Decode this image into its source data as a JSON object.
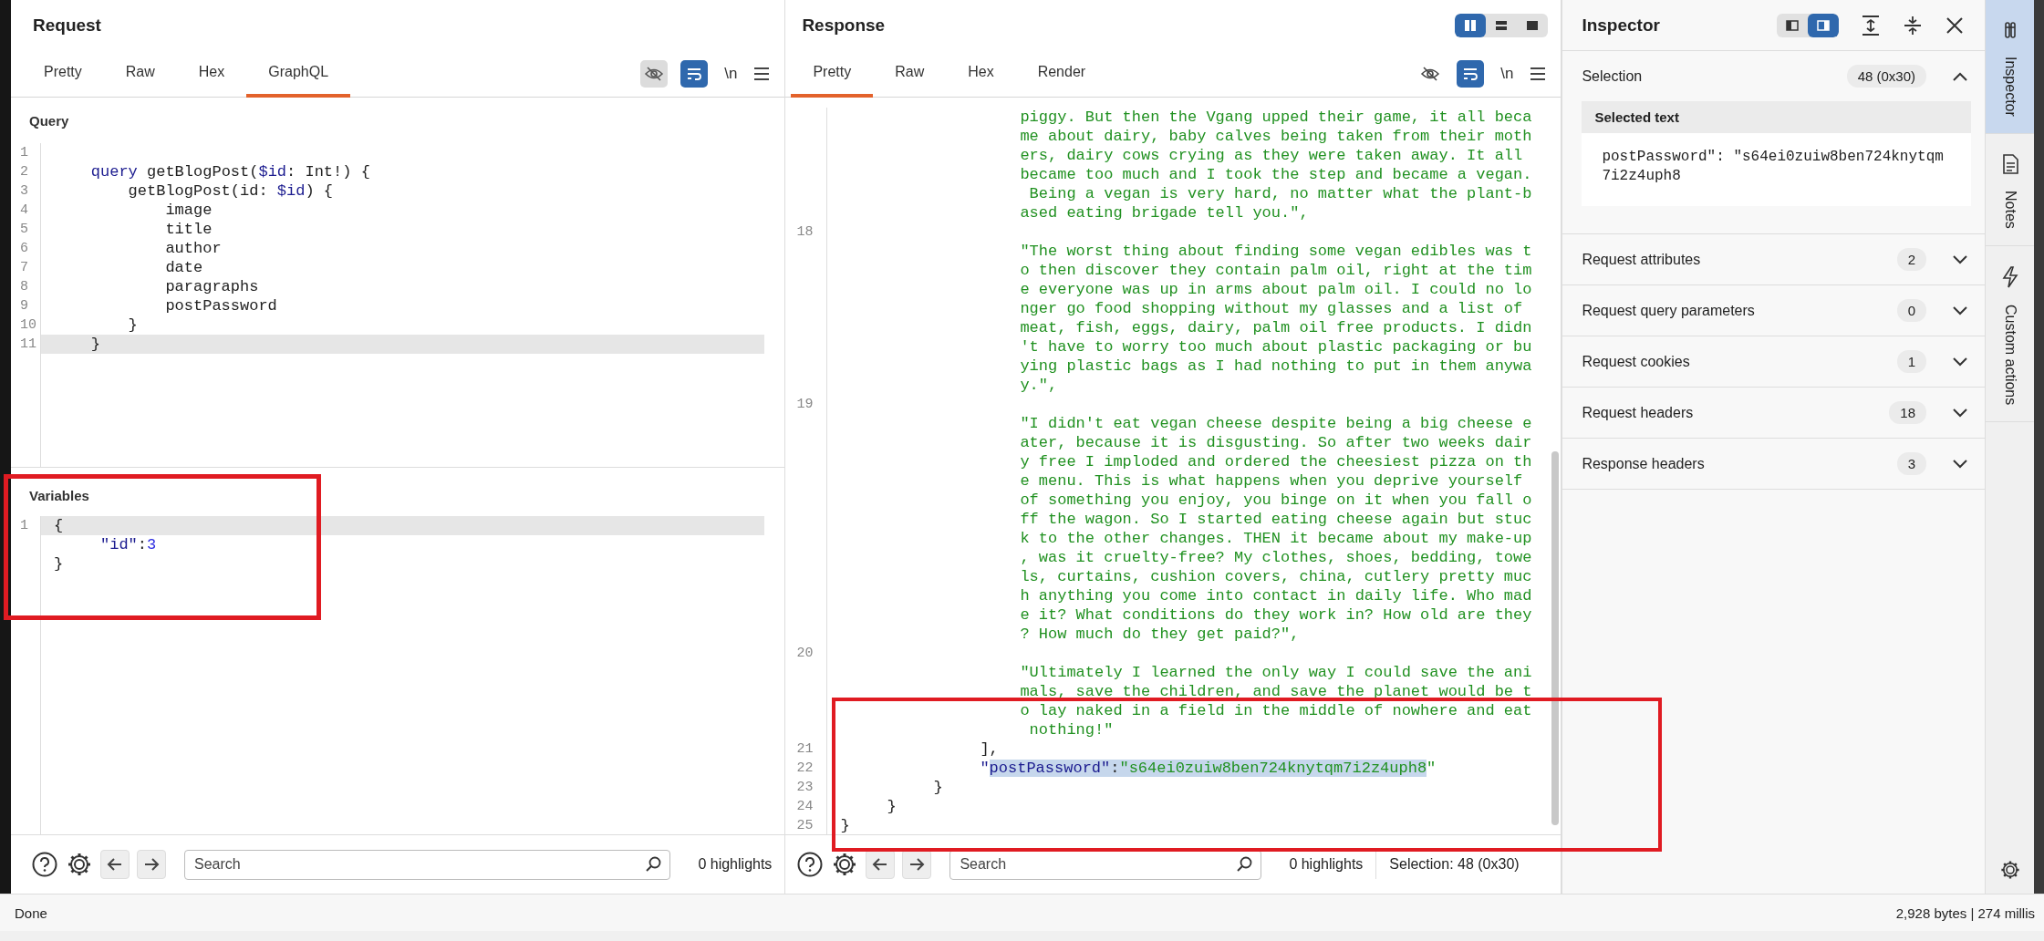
{
  "request": {
    "title": "Request",
    "tabs": [
      {
        "label": "Pretty",
        "selected": false
      },
      {
        "label": "Raw",
        "selected": false
      },
      {
        "label": "Hex",
        "selected": false
      },
      {
        "label": "GraphQL",
        "selected": true
      }
    ],
    "eye_toggle_on": true,
    "newline_label": "\\n",
    "query_label": "Query",
    "query_lines": [
      {
        "number": "1",
        "current": false
      },
      {
        "number": "2",
        "current": false,
        "segments": [
          {
            "kind": "kw",
            "text": "    query"
          },
          {
            "kind": "plain",
            "text": " getBlogPost("
          },
          {
            "kind": "var",
            "text": "$id"
          },
          {
            "kind": "plain",
            "text": ": Int!) {"
          }
        ]
      },
      {
        "number": "3",
        "current": false,
        "segments": [
          {
            "kind": "plain",
            "text": "        getBlogPost(id: "
          },
          {
            "kind": "var",
            "text": "$id"
          },
          {
            "kind": "plain",
            "text": ") {"
          }
        ]
      },
      {
        "number": "4",
        "current": false,
        "segments": [
          {
            "kind": "plain",
            "text": "            image"
          }
        ]
      },
      {
        "number": "5",
        "current": false,
        "segments": [
          {
            "kind": "plain",
            "text": "            title"
          }
        ]
      },
      {
        "number": "6",
        "current": false,
        "segments": [
          {
            "kind": "plain",
            "text": "            author"
          }
        ]
      },
      {
        "number": "7",
        "current": false,
        "segments": [
          {
            "kind": "plain",
            "text": "            date"
          }
        ]
      },
      {
        "number": "8",
        "current": false,
        "segments": [
          {
            "kind": "plain",
            "text": "            paragraphs"
          }
        ]
      },
      {
        "number": "9",
        "current": false,
        "segments": [
          {
            "kind": "plain",
            "text": "            postPassword"
          }
        ]
      },
      {
        "number": "10",
        "current": false,
        "segments": [
          {
            "kind": "plain",
            "text": "        }"
          }
        ]
      },
      {
        "number": "11",
        "current": true,
        "segments": [
          {
            "kind": "plain",
            "text": "    }"
          }
        ]
      }
    ],
    "variables_label": "Variables",
    "variables_lines": [
      {
        "number": "1",
        "current": true,
        "segments": [
          {
            "kind": "plain",
            "text": "{"
          }
        ]
      },
      {
        "current": false,
        "segments": [
          {
            "kind": "key",
            "text": "     \"id\""
          },
          {
            "kind": "plain",
            "text": ":"
          },
          {
            "kind": "num",
            "text": "3"
          }
        ]
      },
      {
        "current": false,
        "segments": [
          {
            "kind": "plain",
            "text": "}"
          }
        ]
      }
    ],
    "search_placeholder": "Search",
    "highlights": "0 highlights"
  },
  "response": {
    "title": "Response",
    "layout_buttons": [
      {
        "selected": true
      },
      {
        "selected": false
      },
      {
        "selected": false
      }
    ],
    "tabs": [
      {
        "label": "Pretty",
        "selected": true
      },
      {
        "label": "Raw",
        "selected": false
      },
      {
        "label": "Hex",
        "selected": false
      },
      {
        "label": "Render",
        "selected": false
      }
    ],
    "eye_toggle_on": false,
    "newline_label": "\\n",
    "rows": [
      {
        "kind": "wrap",
        "text": "piggy. But then the Vgang upped their game, it all beca"
      },
      {
        "kind": "wrap",
        "text": "me about dairy, baby calves being taken from their moth"
      },
      {
        "kind": "wrap",
        "text": "ers, dairy cows crying as they were taken away. It all "
      },
      {
        "kind": "wrap",
        "text": "became too much and I took the step and became a vegan."
      },
      {
        "kind": "wrap",
        "text": " Being a vegan is very hard, no matter what the plant-b"
      },
      {
        "kind": "wrap",
        "text": "ased eating brigade tell you.\","
      },
      {
        "kind": "code",
        "number": "18"
      },
      {
        "kind": "wrap",
        "text": "\"The worst thing about finding some vegan edibles was t"
      },
      {
        "kind": "wrap",
        "text": "o then discover they contain palm oil, right at the tim"
      },
      {
        "kind": "wrap",
        "text": "e everyone was up in arms about palm oil. I could no lo"
      },
      {
        "kind": "wrap",
        "text": "nger go food shopping without my glasses and a list of "
      },
      {
        "kind": "wrap",
        "text": "meat, fish, eggs, dairy, palm oil free products. I didn"
      },
      {
        "kind": "wrap",
        "text": "'t have to worry too much about plastic packaging or bu"
      },
      {
        "kind": "wrap",
        "text": "ying plastic bags as I had nothing to put in them anywa"
      },
      {
        "kind": "wrap",
        "text": "y.\","
      },
      {
        "kind": "code",
        "number": "19"
      },
      {
        "kind": "wrap",
        "text": "\"I didn't eat vegan cheese despite being a big cheese e"
      },
      {
        "kind": "wrap",
        "text": "ater, because it is disgusting. So after two weeks dair"
      },
      {
        "kind": "wrap",
        "text": "y free I imploded and ordered the cheesiest pizza on th"
      },
      {
        "kind": "wrap",
        "text": "e menu. This is what happens when you deprive yourself "
      },
      {
        "kind": "wrap",
        "text": "of something you enjoy, you binge on it when you fall o"
      },
      {
        "kind": "wrap",
        "text": "ff the wagon. So I started eating cheese again but stuc"
      },
      {
        "kind": "wrap",
        "text": "k to the other changes. THEN it became about my make-up"
      },
      {
        "kind": "wrap",
        "text": ", was it cruelty-free? My clothes, shoes, bedding, towe"
      },
      {
        "kind": "wrap",
        "text": "ls, curtains, cushion covers, china, cutlery pretty muc"
      },
      {
        "kind": "wrap",
        "text": "h anything you come into contact in daily life. Who mad"
      },
      {
        "kind": "wrap",
        "text": "e it? What conditions do they work in? How old are they"
      },
      {
        "kind": "wrap",
        "text": "? How much do they get paid?\","
      },
      {
        "kind": "code",
        "number": "20"
      },
      {
        "kind": "wrap",
        "text": "\"Ultimately I learned the only way I could save the ani"
      },
      {
        "kind": "wrap",
        "text": "mals, save the children, and save the planet would be t"
      },
      {
        "kind": "wrap",
        "text": "o lay naked in a field in the middle of nowhere and eat"
      },
      {
        "kind": "wrap",
        "text": " nothing!\""
      },
      {
        "kind": "code",
        "number": "21",
        "segments": [
          {
            "kind": "plain",
            "text": "               ],",
            "selected": false
          }
        ]
      },
      {
        "kind": "code",
        "number": "22",
        "segments": [
          {
            "kind": "key",
            "text": "               \"",
            "selected": false
          },
          {
            "kind": "key",
            "text": "postPassword\"",
            "selected": true
          },
          {
            "kind": "plain",
            "text": ":",
            "selected": true
          },
          {
            "kind": "str",
            "text": "\"s64ei0zuiw8ben724knytqm7i2z4uph8",
            "selected": true
          },
          {
            "kind": "str",
            "text": "\"",
            "selected": false
          }
        ]
      },
      {
        "kind": "code",
        "number": "23",
        "segments": [
          {
            "kind": "plain",
            "text": "          }",
            "selected": false
          }
        ]
      },
      {
        "kind": "code",
        "number": "24",
        "segments": [
          {
            "kind": "plain",
            "text": "     }",
            "selected": false
          }
        ]
      },
      {
        "kind": "code",
        "number": "25",
        "segments": [
          {
            "kind": "plain",
            "text": "}",
            "selected": false
          }
        ]
      }
    ],
    "search_placeholder": "Search",
    "highlights": "0 highlights",
    "selection": "Selection: 48 (0x30)"
  },
  "inspector": {
    "title": "Inspector",
    "layout_buttons": [
      {
        "selected": false
      },
      {
        "selected": true
      }
    ],
    "sections": [
      {
        "label": "Selection",
        "count": "48 (0x30)",
        "expanded": true,
        "subheading": "Selected text",
        "content": "postPassword\": \"s64ei0zuiw8ben724knytqm7i2z4uph8"
      },
      {
        "label": "Request attributes",
        "count": "2",
        "expanded": false
      },
      {
        "label": "Request query parameters",
        "count": "0",
        "expanded": false
      },
      {
        "label": "Request cookies",
        "count": "1",
        "expanded": false
      },
      {
        "label": "Request headers",
        "count": "18",
        "expanded": false
      },
      {
        "label": "Response headers",
        "count": "3",
        "expanded": false
      }
    ]
  },
  "side_tabs": [
    {
      "label": "Inspector",
      "kind": "inspector",
      "selected": true
    },
    {
      "label": "Notes",
      "kind": "notes",
      "selected": false
    },
    {
      "label": "Custom actions",
      "kind": "actions",
      "selected": false
    }
  ],
  "status_bar": {
    "left": "Done",
    "right": "2,928 bytes | 274 millis"
  },
  "annotations": [
    {
      "kind": "frame"
    },
    {
      "kind": "frame"
    }
  ]
}
